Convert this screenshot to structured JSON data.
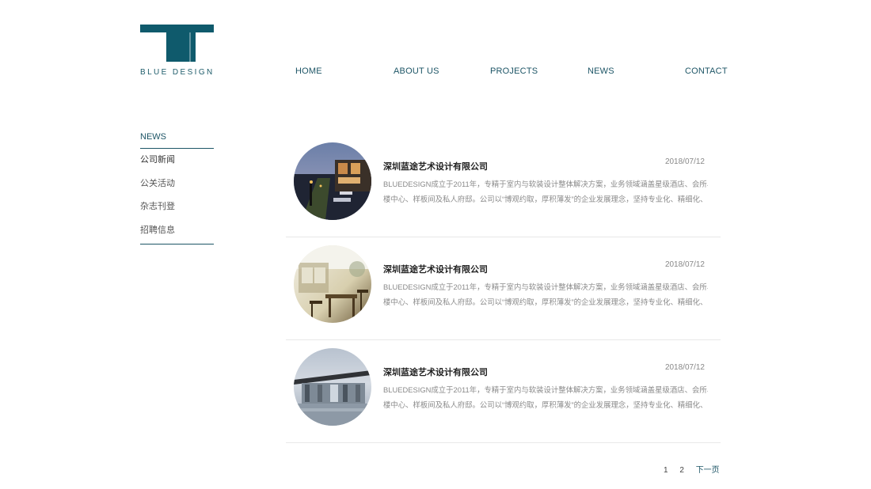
{
  "brand": {
    "logo_text": "BLUE DESIGN",
    "color": "#0f5a6c"
  },
  "nav": {
    "home": "HOME",
    "about": "ABOUT US",
    "projects": "PROJECTS",
    "news": "NEWS",
    "contact": "CONTACT"
  },
  "sidebar": {
    "title": "NEWS",
    "items": [
      {
        "label": "公司新闻"
      },
      {
        "label": "公关活动"
      },
      {
        "label": "杂志刊登"
      },
      {
        "label": "招聘信息"
      }
    ]
  },
  "news": [
    {
      "title": "深圳蓝途艺术设计有限公司",
      "date": "2018/07/12",
      "desc_line1": "BLUEDESIGN成立于2011年，专精于室内与软装设计整体解决方案，业务领域涵盖星级酒店、会所、售",
      "desc_line2": "楼中心、样板间及私人府邸。公司以“博观约取，厚积薄发”的企业发展理念，坚持专业化、精细化、...",
      "thumb": "rooftop-terrace-image"
    },
    {
      "title": "深圳蓝途艺术设计有限公司",
      "date": "2018/07/12",
      "desc_line1": "BLUEDESIGN成立于2011年，专精于室内与软装设计整体解决方案，业务领域涵盖星级酒店、会所、售",
      "desc_line2": "楼中心、样板间及私人府邸。公司以“博观约取，厚积薄发”的企业发展理念，坚持专业化、精细化、...",
      "thumb": "cafe-interior-image"
    },
    {
      "title": "深圳蓝途艺术设计有限公司",
      "date": "2018/07/12",
      "desc_line1": "BLUEDESIGN成立于2011年，专精于室内与软装设计整体解决方案，业务领域涵盖星级酒店、会所、售",
      "desc_line2": "楼中心、样板间及私人府邸。公司以“博观约取，厚积薄发”的企业发展理念，坚持专业化、精细化、...",
      "thumb": "glass-pavilion-image"
    }
  ],
  "pagination": {
    "page1": "1",
    "page2": "2",
    "next": "下一页"
  }
}
